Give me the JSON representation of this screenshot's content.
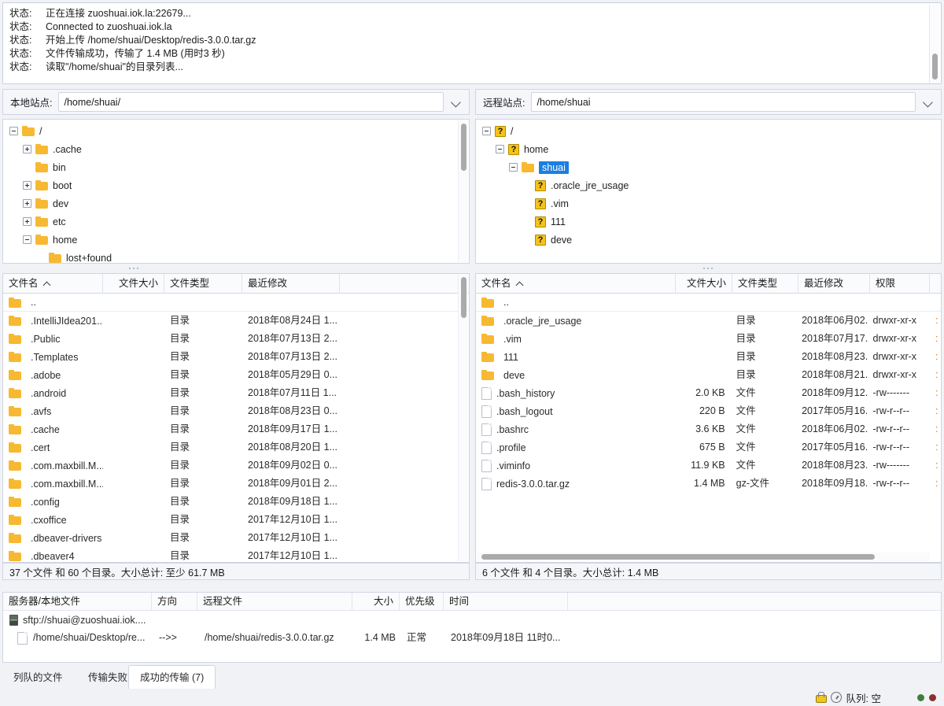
{
  "log": {
    "entries": [
      {
        "label": "状态:",
        "text": "正在连接 zuoshuai.iok.la:22679..."
      },
      {
        "label": "状态:",
        "text": "Connected to zuoshuai.iok.la"
      },
      {
        "label": "状态:",
        "text": "开始上传 /home/shuai/Desktop/redis-3.0.0.tar.gz"
      },
      {
        "label": "状态:",
        "text": "文件传输成功，传输了 1.4 MB (用时3 秒)"
      },
      {
        "label": "状态:",
        "text": "读取\"/home/shuai\"的目录列表..."
      }
    ]
  },
  "local": {
    "path_label": "本地站点:",
    "path_value": "/home/shuai/",
    "tree": [
      {
        "name": "/",
        "indent": 0,
        "twisty": "minus",
        "icon": "folder",
        "selected": false
      },
      {
        "name": ".cache",
        "indent": 1,
        "twisty": "plus",
        "icon": "folder",
        "selected": false
      },
      {
        "name": "bin",
        "indent": 1,
        "twisty": "none",
        "icon": "folder",
        "selected": false
      },
      {
        "name": "boot",
        "indent": 1,
        "twisty": "plus",
        "icon": "folder",
        "selected": false
      },
      {
        "name": "dev",
        "indent": 1,
        "twisty": "plus",
        "icon": "folder",
        "selected": false
      },
      {
        "name": "etc",
        "indent": 1,
        "twisty": "plus",
        "icon": "folder",
        "selected": false
      },
      {
        "name": "home",
        "indent": 1,
        "twisty": "minus",
        "icon": "folder",
        "selected": false
      },
      {
        "name": "lost+found",
        "indent": 2,
        "twisty": "none",
        "icon": "folder",
        "selected": false
      }
    ],
    "columns": [
      "文件名",
      "文件大小",
      "文件类型",
      "最近修改"
    ],
    "updir": "..",
    "rows": [
      {
        "name": ".IntelliJIdea201...",
        "size": "",
        "type": "目录",
        "modified": "2018年08月24日 1..."
      },
      {
        "name": ".Public",
        "size": "",
        "type": "目录",
        "modified": "2018年07月13日 2..."
      },
      {
        "name": ".Templates",
        "size": "",
        "type": "目录",
        "modified": "2018年07月13日 2..."
      },
      {
        "name": ".adobe",
        "size": "",
        "type": "目录",
        "modified": "2018年05月29日 0..."
      },
      {
        "name": ".android",
        "size": "",
        "type": "目录",
        "modified": "2018年07月11日 1..."
      },
      {
        "name": ".avfs",
        "size": "",
        "type": "目录",
        "modified": "2018年08月23日 0..."
      },
      {
        "name": ".cache",
        "size": "",
        "type": "目录",
        "modified": "2018年09月17日 1..."
      },
      {
        "name": ".cert",
        "size": "",
        "type": "目录",
        "modified": "2018年08月20日 1..."
      },
      {
        "name": ".com.maxbill.M...",
        "size": "",
        "type": "目录",
        "modified": "2018年09月02日 0..."
      },
      {
        "name": ".com.maxbill.M...",
        "size": "",
        "type": "目录",
        "modified": "2018年09月01日 2..."
      },
      {
        "name": ".config",
        "size": "",
        "type": "目录",
        "modified": "2018年09月18日 1..."
      },
      {
        "name": ".cxoffice",
        "size": "",
        "type": "目录",
        "modified": "2017年12月10日 1..."
      },
      {
        "name": ".dbeaver-drivers",
        "size": "",
        "type": "目录",
        "modified": "2017年12月10日 1..."
      },
      {
        "name": ".dbeaver4",
        "size": "",
        "type": "目录",
        "modified": "2017年12月10日 1..."
      }
    ],
    "status": "37 个文件 和 60 个目录。大小总计: 至少 61.7 MB"
  },
  "remote": {
    "path_label": "远程站点:",
    "path_value": "/home/shuai",
    "tree": [
      {
        "name": "/",
        "indent": 0,
        "twisty": "minus",
        "icon": "question",
        "selected": false
      },
      {
        "name": "home",
        "indent": 1,
        "twisty": "minus",
        "icon": "question",
        "selected": false
      },
      {
        "name": "shuai",
        "indent": 2,
        "twisty": "minus",
        "icon": "folder",
        "selected": true
      },
      {
        "name": ".oracle_jre_usage",
        "indent": 3,
        "twisty": "none",
        "icon": "question",
        "selected": false
      },
      {
        "name": ".vim",
        "indent": 3,
        "twisty": "none",
        "icon": "question",
        "selected": false
      },
      {
        "name": "111",
        "indent": 3,
        "twisty": "none",
        "icon": "question",
        "selected": false
      },
      {
        "name": "deve",
        "indent": 3,
        "twisty": "none",
        "icon": "question",
        "selected": false
      }
    ],
    "columns": [
      "文件名",
      "文件大小",
      "文件类型",
      "最近修改",
      "权限"
    ],
    "updir": "..",
    "rows": [
      {
        "name": ".oracle_jre_usage",
        "icon": "folder",
        "size": "",
        "type": "目录",
        "modified": "2018年06月02...",
        "perm": "drwxr-xr-x"
      },
      {
        "name": ".vim",
        "icon": "folder",
        "size": "",
        "type": "目录",
        "modified": "2018年07月17...",
        "perm": "drwxr-xr-x"
      },
      {
        "name": "111",
        "icon": "folder",
        "size": "",
        "type": "目录",
        "modified": "2018年08月23...",
        "perm": "drwxr-xr-x"
      },
      {
        "name": "deve",
        "icon": "folder",
        "size": "",
        "type": "目录",
        "modified": "2018年08月21...",
        "perm": "drwxr-xr-x"
      },
      {
        "name": ".bash_history",
        "icon": "file",
        "size": "2.0 KB",
        "type": "文件",
        "modified": "2018年09月12...",
        "perm": "-rw-------"
      },
      {
        "name": ".bash_logout",
        "icon": "file",
        "size": "220 B",
        "type": "文件",
        "modified": "2017年05月16...",
        "perm": "-rw-r--r--"
      },
      {
        "name": ".bashrc",
        "icon": "file",
        "size": "3.6 KB",
        "type": "文件",
        "modified": "2018年06月02...",
        "perm": "-rw-r--r--"
      },
      {
        "name": ".profile",
        "icon": "file",
        "size": "675 B",
        "type": "文件",
        "modified": "2017年05月16...",
        "perm": "-rw-r--r--"
      },
      {
        "name": ".viminfo",
        "icon": "file",
        "size": "11.9 KB",
        "type": "文件",
        "modified": "2018年08月23...",
        "perm": "-rw-------"
      },
      {
        "name": "redis-3.0.0.tar.gz",
        "icon": "file",
        "size": "1.4 MB",
        "type": "gz-文件",
        "modified": "2018年09月18...",
        "perm": "-rw-r--r--"
      }
    ],
    "status": "6 个文件 和 4 个目录。大小总计: 1.4 MB"
  },
  "queue": {
    "columns": [
      "服务器/本地文件",
      "方向",
      "远程文件",
      "大小",
      "优先级",
      "时间"
    ],
    "server_row": "sftp://shuai@zuoshuai.iok....",
    "rows": [
      {
        "local_file": "/home/shuai/Desktop/re...",
        "direction": "-->>",
        "remote_file": "/home/shuai/redis-3.0.0.tar.gz",
        "size": "1.4 MB",
        "priority": "正常",
        "time": "2018年09月18日 11时0..."
      }
    ]
  },
  "tabs": [
    {
      "label": "列队的文件",
      "active": false
    },
    {
      "label": "传输失败",
      "active": false
    },
    {
      "label": "成功的传输 (7)",
      "active": true
    }
  ],
  "statusbar": {
    "queue_text": "队列: 空"
  },
  "colors": {
    "folder": "#f7b931",
    "selection": "#1a7fe0",
    "lock": "#f2c521",
    "dot_green": "#3f7d3f",
    "dot_red": "#8a2f2f",
    "owner_text": "#d17a16"
  }
}
